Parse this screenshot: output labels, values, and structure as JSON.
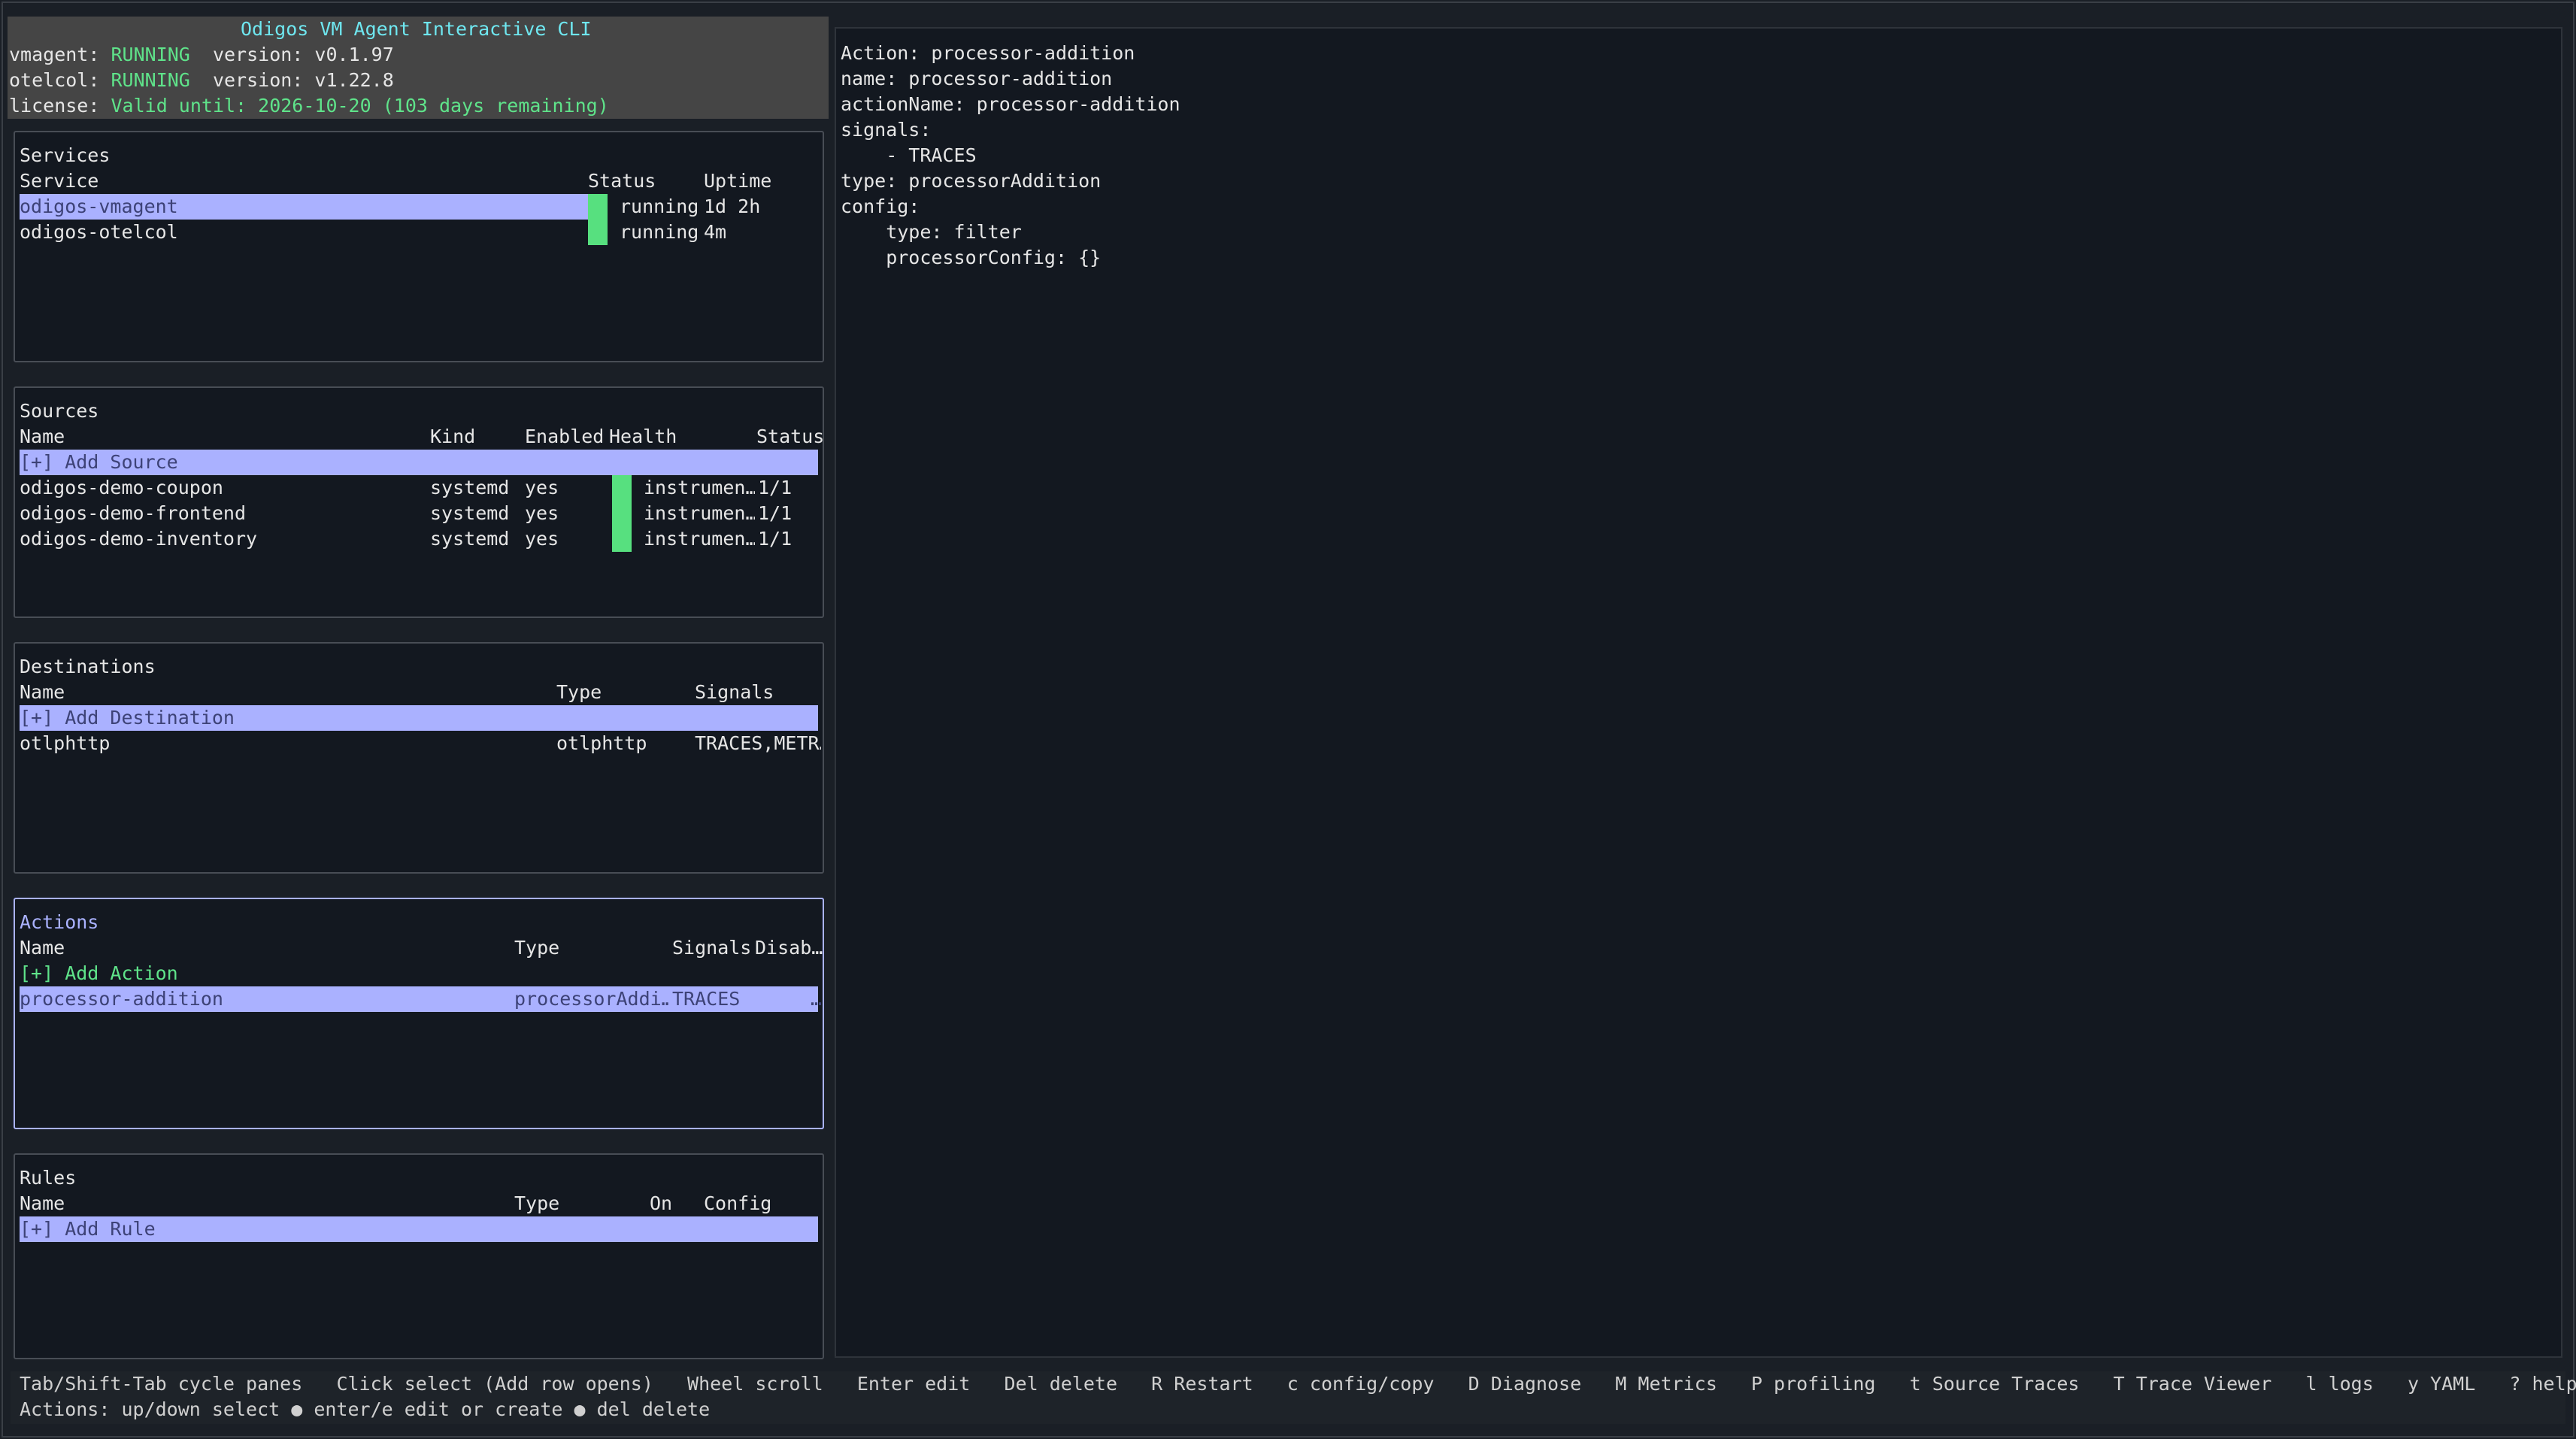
{
  "header": {
    "title": "Odigos VM Agent Interactive CLI",
    "vmagent": {
      "label": "vmagent:",
      "status": "RUNNING",
      "version": "version: v0.1.97"
    },
    "otelcol": {
      "label": "otelcol:",
      "status": "RUNNING",
      "version": "version: v1.22.8"
    },
    "license": {
      "label": "license:",
      "value": "Valid until: 2026-10-20 (103 days remaining)"
    }
  },
  "services": {
    "title": "Services",
    "columns": [
      "Service",
      "Status",
      "Uptime"
    ],
    "rows": [
      {
        "name": "odigos-vmagent",
        "status": "running",
        "uptime": "1d 2h"
      },
      {
        "name": "odigos-otelcol",
        "status": "running",
        "uptime": "4m"
      }
    ]
  },
  "sources": {
    "title": "Sources",
    "columns": [
      "Name",
      "Kind",
      "Enabled",
      "Health",
      "Status"
    ],
    "add_label": "[+] Add Source",
    "rows": [
      {
        "name": "odigos-demo-coupon",
        "kind": "systemd",
        "enabled": "yes",
        "health": "instrumen…",
        "status": "1/1"
      },
      {
        "name": "odigos-demo-frontend",
        "kind": "systemd",
        "enabled": "yes",
        "health": "instrumen…",
        "status": "1/1"
      },
      {
        "name": "odigos-demo-inventory",
        "kind": "systemd",
        "enabled": "yes",
        "health": "instrumen…",
        "status": "1/1"
      }
    ]
  },
  "destinations": {
    "title": "Destinations",
    "columns": [
      "Name",
      "Type",
      "Signals"
    ],
    "add_label": "[+] Add Destination",
    "rows": [
      {
        "name": "otlphttp",
        "type": "otlphttp",
        "signals": "TRACES,METR…"
      }
    ]
  },
  "actions": {
    "title": "Actions",
    "columns": [
      "Name",
      "Type",
      "Signals",
      "Disab…"
    ],
    "add_label": "[+] Add Action",
    "rows": [
      {
        "name": "processor-addition",
        "type": "processorAddi…",
        "signals": "TRACES",
        "disabled": "…"
      }
    ]
  },
  "rules": {
    "title": "Rules",
    "columns": [
      "Name",
      "Type",
      "On",
      "Config"
    ],
    "add_label": "[+] Add Rule"
  },
  "detail": {
    "lines": [
      "Action: processor-addition",
      "name: processor-addition",
      "actionName: processor-addition",
      "signals:",
      "    - TRACES",
      "type: processorAddition",
      "config:",
      "    type: filter",
      "    processorConfig: {}"
    ]
  },
  "footer": {
    "shortcuts": [
      "Tab/Shift-Tab cycle panes",
      "Click select (Add row opens)",
      "Wheel scroll",
      "Enter edit",
      "Del delete",
      "R Restart",
      "c config/copy",
      "D Diagnose",
      "M Metrics",
      "P profiling",
      "t Source Traces",
      "T Trace Viewer",
      "l logs",
      "y YAML",
      "? help"
    ],
    "status": "Actions: up/down select ● enter/e edit or create ● del delete"
  },
  "colors": {
    "background": "#1a1f26",
    "panel": "#131820",
    "selection": "#aab1ff",
    "running": "#5fe38a",
    "title": "#6fe7f0",
    "health_bar": "#57e07f"
  }
}
